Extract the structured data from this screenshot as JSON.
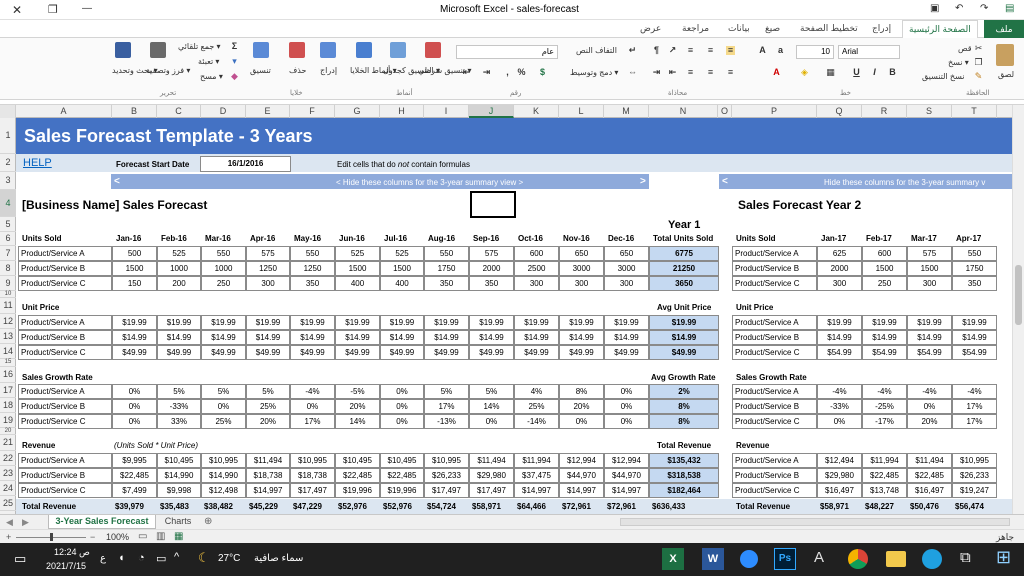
{
  "window": {
    "title": "Microsoft Excel - sales-forecast",
    "close": "✕",
    "restore": "❐",
    "min": "—"
  },
  "tabs": [
    "ملف",
    "الصفحة الرئيسية",
    "إدراج",
    "تخطيط الصفحة",
    "صيغ",
    "بيانات",
    "مراجعة",
    "عرض"
  ],
  "ribbon": {
    "clipboard": {
      "paste": "لصق",
      "cut": "قص",
      "copy": "نسخ ▾",
      "painter": "نسخ التنسيق",
      "label": "الحافظة"
    },
    "font": {
      "name": "Arial",
      "size": "10",
      "label": "خط"
    },
    "alignment": {
      "wrap": "التفاف النص",
      "merge": "دمج وتوسيط ▾",
      "label": "محاذاة"
    },
    "number": {
      "format": "عام",
      "pct": "%",
      "comma": ",",
      "label": "رقم"
    },
    "styles": {
      "cond": "تنسيق شرطي ▾",
      "table": "التنسيق كجدول ▾",
      "cell": "أنماط الخلايا ▾",
      "label": "أنماط"
    },
    "cells": {
      "insert": "إدراج",
      "delete": "حذف",
      "format": "تنسيق",
      "label": "خلايا"
    },
    "editing": {
      "autosum": "جمع تلقائي ▾",
      "fill": "تعبئة ▾",
      "clear": "مسح ▾",
      "sort": "فرز وتصفية ▾",
      "find": "بحث وتحديد ▾",
      "label": "تحرير"
    }
  },
  "columns": [
    "A",
    "B",
    "C",
    "D",
    "E",
    "F",
    "G",
    "H",
    "I",
    "J",
    "K",
    "L",
    "M",
    "N",
    "O",
    "P",
    "Q",
    "R",
    "S",
    "T"
  ],
  "rows": [
    "1",
    "2",
    "3",
    "4",
    "5",
    "6",
    "7",
    "8",
    "9",
    "10",
    "11",
    "12",
    "13",
    "14",
    "15",
    "16",
    "17",
    "18",
    "19",
    "20",
    "21",
    "22",
    "23",
    "24",
    "25"
  ],
  "sheet": {
    "title": "Sales Forecast Template - 3 Years",
    "help": "HELP",
    "start_label": "Forecast Start Date",
    "start_value": "16/1/2016",
    "edit_note_a": "Edit cells that do ",
    "edit_note_b": "not",
    "edit_note_c": " contain formulas",
    "hide_bar": "< Hide these columns for the 3-year summary view >",
    "hide_bar2": "Hide these columns for the 3-year summary v",
    "lt": "<",
    "gt": ">",
    "biz_title": "[Business Name] Sales Forecast",
    "year1": "Year 1",
    "year2_title": "Sales Forecast Year 2",
    "units_label": "Units Sold",
    "months1": [
      "Jan-16",
      "Feb-16",
      "Mar-16",
      "Apr-16",
      "May-16",
      "Jun-16",
      "Jul-16",
      "Aug-16",
      "Sep-16",
      "Oct-16",
      "Nov-16",
      "Dec-16"
    ],
    "total_units": "Total Units Sold",
    "months2": [
      "Jan-17",
      "Feb-17",
      "Mar-17",
      "Apr-17"
    ],
    "products": [
      "Product/Service A",
      "Product/Service B",
      "Product/Service C"
    ],
    "units1": [
      [
        "500",
        "525",
        "550",
        "575",
        "550",
        "525",
        "525",
        "550",
        "575",
        "600",
        "650",
        "650",
        "6775"
      ],
      [
        "1500",
        "1000",
        "1000",
        "1250",
        "1250",
        "1500",
        "1500",
        "1750",
        "2000",
        "2500",
        "3000",
        "3000",
        "21250"
      ],
      [
        "150",
        "200",
        "250",
        "300",
        "350",
        "400",
        "400",
        "350",
        "350",
        "300",
        "300",
        "300",
        "3650"
      ]
    ],
    "units2": [
      [
        "625",
        "600",
        "575",
        "550"
      ],
      [
        "2000",
        "1500",
        "1500",
        "1750"
      ],
      [
        "300",
        "250",
        "300",
        "350"
      ]
    ],
    "price_label": "Unit Price",
    "avg_price": "Avg Unit Price",
    "price1": [
      [
        "$19.99",
        "$19.99",
        "$19.99",
        "$19.99",
        "$19.99",
        "$19.99",
        "$19.99",
        "$19.99",
        "$19.99",
        "$19.99",
        "$19.99",
        "$19.99",
        "$19.99"
      ],
      [
        "$14.99",
        "$14.99",
        "$14.99",
        "$14.99",
        "$14.99",
        "$14.99",
        "$14.99",
        "$14.99",
        "$14.99",
        "$14.99",
        "$14.99",
        "$14.99",
        "$14.99"
      ],
      [
        "$49.99",
        "$49.99",
        "$49.99",
        "$49.99",
        "$49.99",
        "$49.99",
        "$49.99",
        "$49.99",
        "$49.99",
        "$49.99",
        "$49.99",
        "$49.99",
        "$49.99"
      ]
    ],
    "price2": [
      [
        "$19.99",
        "$19.99",
        "$19.99",
        "$19.99"
      ],
      [
        "$14.99",
        "$14.99",
        "$14.99",
        "$14.99"
      ],
      [
        "$54.99",
        "$54.99",
        "$54.99",
        "$54.99"
      ]
    ],
    "growth_label": "Sales Growth Rate",
    "avg_growth": "Avg Growth Rate",
    "growth1": [
      [
        "0%",
        "5%",
        "5%",
        "5%",
        "-4%",
        "-5%",
        "0%",
        "5%",
        "5%",
        "4%",
        "8%",
        "0%",
        "2%"
      ],
      [
        "0%",
        "-33%",
        "0%",
        "25%",
        "0%",
        "20%",
        "0%",
        "17%",
        "14%",
        "25%",
        "20%",
        "0%",
        "8%"
      ],
      [
        "0%",
        "33%",
        "25%",
        "20%",
        "17%",
        "14%",
        "0%",
        "-13%",
        "0%",
        "-14%",
        "0%",
        "0%",
        "8%"
      ]
    ],
    "growth2": [
      [
        "-4%",
        "-4%",
        "-4%",
        "-4%"
      ],
      [
        "-33%",
        "-25%",
        "0%",
        "17%"
      ],
      [
        "0%",
        "-17%",
        "20%",
        "17%"
      ]
    ],
    "revenue_label": "Revenue",
    "revenue_note": "(Units Sold * Unit Price)",
    "total_revenue": "Total Revenue",
    "rev1": [
      [
        "$9,995",
        "$10,495",
        "$10,995",
        "$11,494",
        "$10,995",
        "$10,495",
        "$10,495",
        "$10,995",
        "$11,494",
        "$11,994",
        "$12,994",
        "$12,994",
        "$135,432"
      ],
      [
        "$22,485",
        "$14,990",
        "$14,990",
        "$18,738",
        "$18,738",
        "$22,485",
        "$22,485",
        "$26,233",
        "$29,980",
        "$37,475",
        "$44,970",
        "$44,970",
        "$318,538"
      ],
      [
        "$7,499",
        "$9,998",
        "$12,498",
        "$14,997",
        "$17,497",
        "$19,996",
        "$19,996",
        "$17,497",
        "$17,497",
        "$14,997",
        "$14,997",
        "$14,997",
        "$182,464"
      ]
    ],
    "rev2": [
      [
        "$12,494",
        "$11,994",
        "$11,494",
        "$10,995"
      ],
      [
        "$29,980",
        "$22,485",
        "$22,485",
        "$26,233"
      ],
      [
        "$16,497",
        "$13,748",
        "$16,497",
        "$19,247"
      ]
    ],
    "total_row_label": "Total Revenue",
    "total1": [
      "$39,979",
      "$35,483",
      "$38,482",
      "$45,229",
      "$47,229",
      "$52,976",
      "$52,976",
      "$54,724",
      "$58,971",
      "$64,466",
      "$72,961",
      "$72,961",
      "$636,433"
    ],
    "total2": [
      "$58,971",
      "$48,227",
      "$50,476",
      "$56,474"
    ]
  },
  "sheet_tabs": [
    "3-Year Sales Forecast",
    "Charts"
  ],
  "status": {
    "ready": "جاهز",
    "zoom": "100%"
  },
  "taskbar": {
    "time": "12:24 ص",
    "date": "2021/7/15",
    "lang": "ع",
    "temp": "27°C",
    "weather": "سماء صافية",
    "ps": "Ps",
    "excel": "X",
    "word": "W"
  },
  "colors": {
    "accent": "#217346",
    "header_band": "#4472c4",
    "subheader_band": "#dce6f1",
    "hide_band": "#8eaadb",
    "total_fill": "#c5d9f1"
  }
}
